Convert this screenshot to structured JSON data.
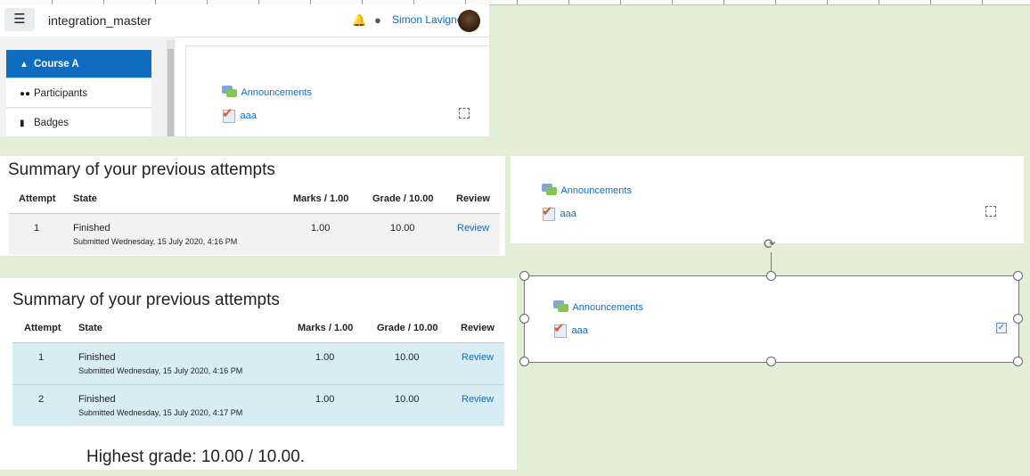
{
  "header": {
    "site_name": "integration_master",
    "user_name": "Simon Lavigne",
    "menu_icon": "hamburger-icon",
    "bell_icon": "bell-icon",
    "chat_icon": "chat-icon"
  },
  "sidebar": {
    "items": [
      {
        "label": "Course A",
        "icon": "graduation-cap-icon"
      },
      {
        "label": "Participants",
        "icon": "users-icon"
      },
      {
        "label": "Badges",
        "icon": "shield-icon"
      }
    ]
  },
  "activities": {
    "announcements": "Announcements",
    "quiz": "aaa"
  },
  "summary": {
    "title": "Summary of your previous attempts",
    "columns": [
      "Attempt",
      "State",
      "Marks / 1.00",
      "Grade / 10.00",
      "Review"
    ],
    "attempts": [
      {
        "attempt": "1",
        "state": "Finished",
        "submitted": "Submitted Wednesday, 15 July 2020, 4:16 PM",
        "marks": "1.00",
        "grade": "10.00",
        "review": "Review"
      },
      {
        "attempt": "2",
        "state": "Finished",
        "submitted": "Submitted Wednesday, 15 July 2020, 4:17 PM",
        "marks": "1.00",
        "grade": "10.00",
        "review": "Review"
      }
    ],
    "highest": "Highest grade: 10.00 / 10.00."
  },
  "colors": {
    "brand": "#0f6cbf",
    "canvas_bg": "#e2eed6",
    "row_grey": "#f2f2f2",
    "row_highlight": "#d7ecf3"
  }
}
